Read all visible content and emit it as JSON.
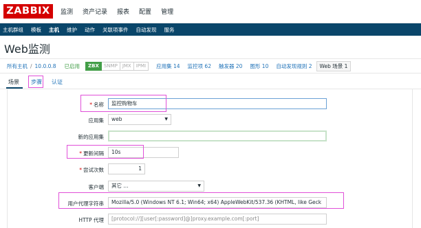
{
  "header": {
    "logo": "ZABBIX",
    "nav": [
      "监测",
      "资产记录",
      "报表",
      "配置",
      "管理"
    ]
  },
  "subnav": {
    "items": [
      "主机群组",
      "模板",
      "主机",
      "维护",
      "动作",
      "关联项事件",
      "自动发现",
      "服务"
    ],
    "active_index": 2
  },
  "page": {
    "title": "Web监测"
  },
  "filter": {
    "all_hosts": "所有主机",
    "separator": "/",
    "host": "10.0.0.8",
    "status": "已启用",
    "badges": [
      "ZBX",
      "SNMP",
      "JMX",
      "IPMI"
    ],
    "app_sets": "应用集 14",
    "monitor_items": "监控项 62",
    "triggers": "触发器 20",
    "graphs": "图形 10",
    "discovery": "自动发现规则 2",
    "web": "Web 场景 1"
  },
  "tabs": [
    "场景",
    "步骤",
    "认证"
  ],
  "form": {
    "name_label": "名称",
    "name_value": "监控购物车",
    "app_label": "应用集",
    "app_value": "web",
    "new_app_label": "新的应用集",
    "new_app_value": "",
    "interval_label": "更新间隔",
    "interval_value": "10s",
    "attempts_label": "尝试次数",
    "attempts_value": "1",
    "client_label": "客户端",
    "client_value": "其它 ...",
    "ua_label": "用户代理字符串",
    "ua_value": "Mozilla/5.0 (Windows NT 6.1; Win64; x64) AppleWebKit/537.36 (KHTML, like Geck",
    "proxy_label": "HTTP 代理",
    "proxy_placeholder": "[protocol://][user[:password]@]proxy.example.com[:port]"
  },
  "colors": {
    "brand": "#d40000",
    "navbar": "#0a466a",
    "link": "#1f72b8",
    "enabled": "#429e47",
    "annotation": "#e04fd8"
  }
}
